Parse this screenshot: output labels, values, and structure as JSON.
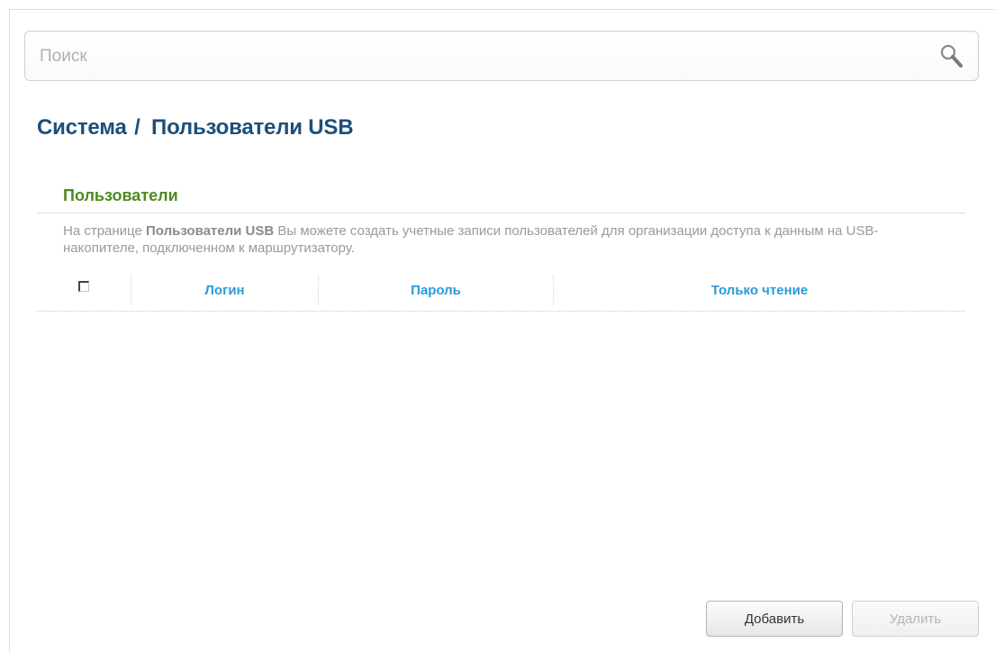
{
  "search": {
    "placeholder": "Поиск",
    "value": "",
    "icon": "search-icon"
  },
  "breadcrumb": {
    "parent": "Система",
    "separator": "/",
    "current": "Пользователи USB"
  },
  "section": {
    "title": "Пользователи",
    "desc_before": "На странице ",
    "desc_bold": "Пользователи USB",
    "desc_after": " Вы можете создать учетные записи пользователей для организации доступа к данным на USB-накопителе, подключенном к маршрутизатору."
  },
  "table": {
    "select_all_checked": false,
    "columns": [
      "Логин",
      "Пароль",
      "Только чтение"
    ],
    "rows": []
  },
  "buttons": {
    "add": "Добавить",
    "delete": "Удалить",
    "delete_disabled": true
  },
  "colors": {
    "title": "#1d4f7a",
    "section_title": "#4e8a1f",
    "column_header": "#2a9ad8",
    "description": "#9a9a9a"
  }
}
